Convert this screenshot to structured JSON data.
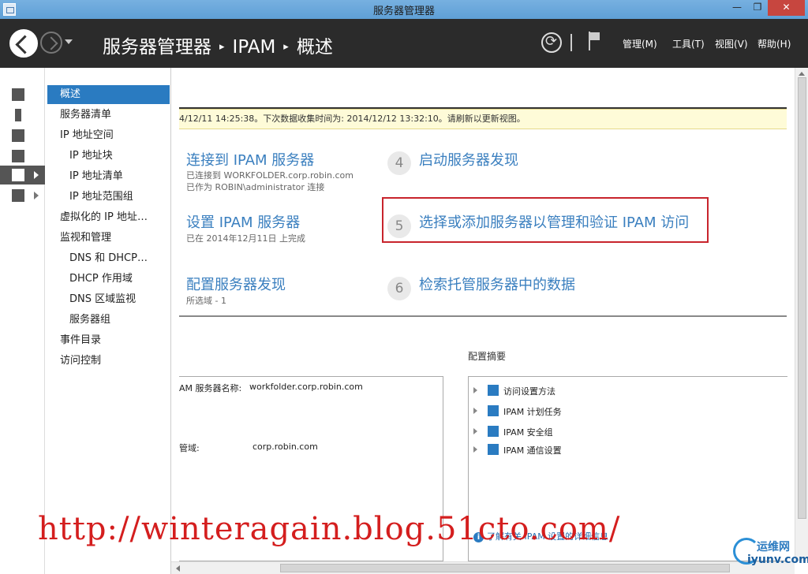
{
  "window": {
    "title": "服务器管理器",
    "min_glyph": "—",
    "max_glyph": "❐",
    "close_glyph": "✕"
  },
  "header": {
    "breadcrumb": [
      "服务器管理器",
      "IPAM",
      "概述"
    ],
    "separator": "▸",
    "menus": [
      "管理(M)",
      "工具(T)",
      "视图(V)",
      "帮助(H)"
    ]
  },
  "rail": {
    "icons": [
      "dashboard-icon",
      "local-server-icon",
      "all-servers-icon",
      "file-storage-icon",
      "ipam-icon",
      "other-role-icon"
    ],
    "active_index": 4
  },
  "tree": {
    "items": [
      {
        "label": "概述",
        "level": 0,
        "selected": true
      },
      {
        "label": "服务器清单",
        "level": 0
      },
      {
        "label": "IP 地址空间",
        "level": 0
      },
      {
        "label": "IP 地址块",
        "level": 1
      },
      {
        "label": "IP 地址清单",
        "level": 1
      },
      {
        "label": "IP 地址范围组",
        "level": 1
      },
      {
        "label": "虚拟化的 IP 地址…",
        "level": 0
      },
      {
        "label": "监视和管理",
        "level": 0
      },
      {
        "label": "DNS 和 DHCP…",
        "level": 1
      },
      {
        "label": "DHCP 作用域",
        "level": 1
      },
      {
        "label": "DNS 区域监视",
        "level": 1
      },
      {
        "label": "服务器组",
        "level": 1
      },
      {
        "label": "事件目录",
        "level": 0
      },
      {
        "label": "访问控制",
        "level": 0
      }
    ]
  },
  "notice": "4/12/11 14:25:38。下次数据收集时间为: 2014/12/12 13:32:10。请刷新以更新视图。",
  "steps": {
    "connect": {
      "title": "连接到 IPAM 服务器",
      "sub1": "已连接到 WORKFOLDER.corp.robin.com",
      "sub2": "已作为 ROBIN\\administrator 连接"
    },
    "setup": {
      "title": "设置 IPAM 服务器",
      "sub1": "已在 2014年12月11日 上完成"
    },
    "discovery": {
      "title": "配置服务器发现",
      "sub1": "所选域 - 1"
    },
    "step4": {
      "num": "4",
      "title": "启动服务器发现"
    },
    "step5": {
      "num": "5",
      "title": "选择或添加服务器以管理和验证 IPAM 访问"
    },
    "step6": {
      "num": "6",
      "title": "检索托管服务器中的数据"
    }
  },
  "summary": {
    "title": "配置摘要",
    "server_label": "AM 服务器名称:",
    "server_value": "workfolder.corp.robin.com",
    "domain_label": "管域:",
    "domain_value": "corp.robin.com",
    "items": [
      "访问设置方法",
      "IPAM 计划任务",
      "IPAM 安全组",
      "IPAM 通信设置"
    ],
    "link": "了解有关 IPAM 设置的详细信息",
    "info_glyph": "i"
  },
  "watermark": "http://winteragain.blog.51cto.com/",
  "logo": {
    "cn": "运维网",
    "en": "iyunv.com"
  }
}
